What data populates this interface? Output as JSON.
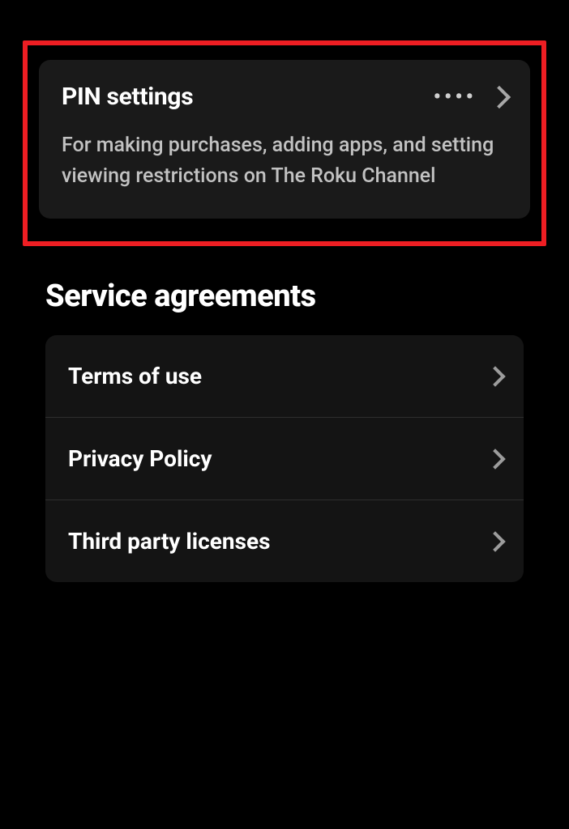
{
  "pin": {
    "title": "PIN settings",
    "dots": "••••",
    "description": "For making purchases, adding apps, and setting viewing restrictions on The Roku Channel"
  },
  "serviceAgreements": {
    "title": "Service agreements",
    "items": [
      {
        "label": "Terms of use"
      },
      {
        "label": "Privacy Policy"
      },
      {
        "label": "Third party licenses"
      }
    ]
  }
}
